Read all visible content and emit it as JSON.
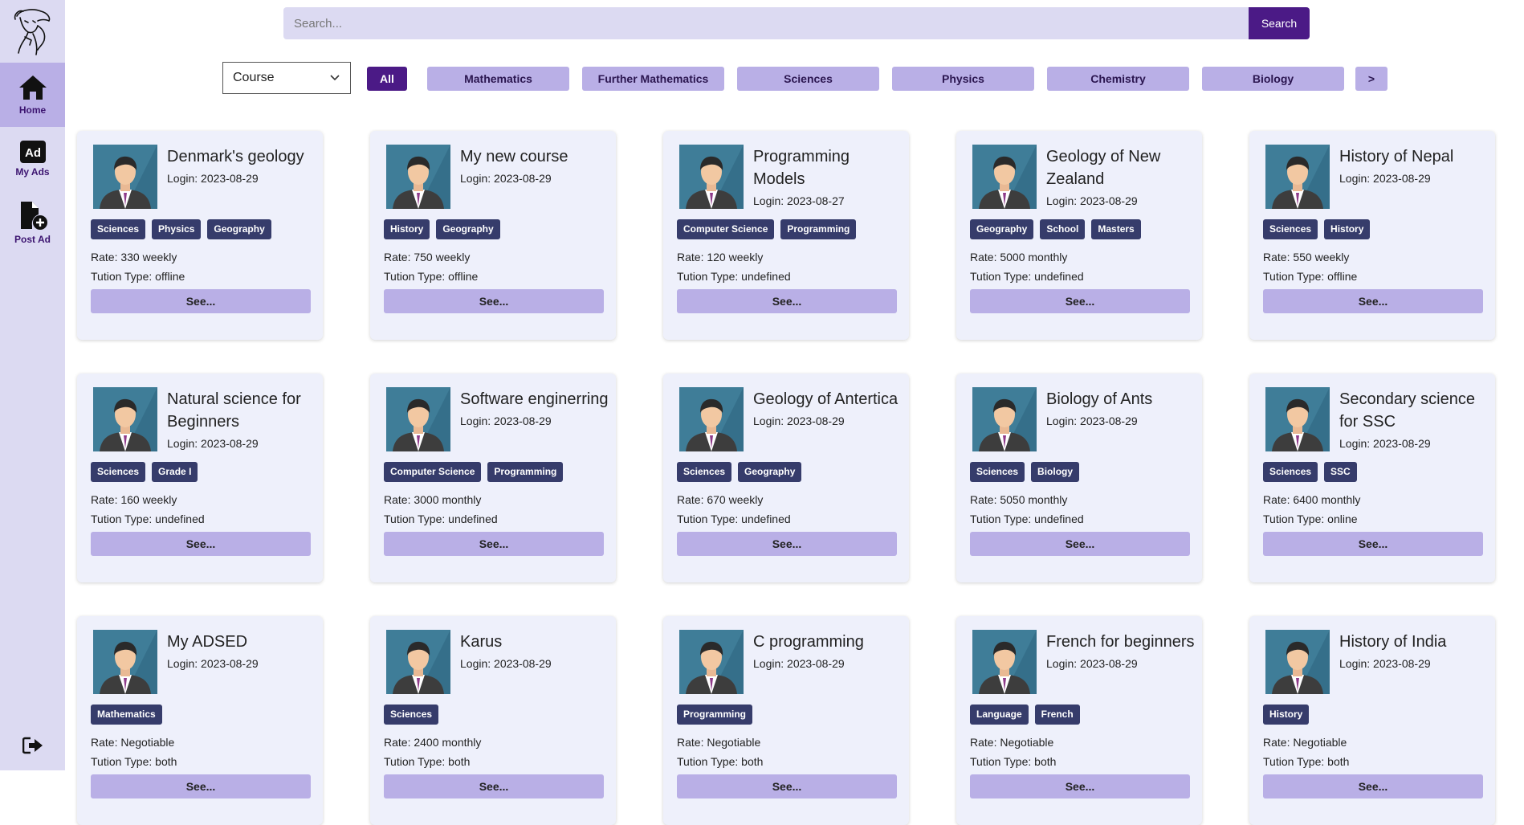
{
  "sidebar": {
    "items": [
      {
        "label": "Home",
        "icon": "home-icon"
      },
      {
        "label": "My Ads",
        "icon": "ad-icon"
      },
      {
        "label": "Post Ad",
        "icon": "file-plus-icon"
      }
    ],
    "logout_icon": "logout-icon"
  },
  "search": {
    "placeholder": "Search...",
    "button": "Search"
  },
  "filters": {
    "select_value": "Course",
    "chips": [
      "All",
      "Mathematics",
      "Further Mathematics",
      "Sciences",
      "Physics",
      "Chemistry",
      "Biology",
      ">"
    ]
  },
  "cards": [
    {
      "title": "Denmark's geology",
      "login": "Login: 2023-08-29",
      "tags": [
        "Sciences",
        "Physics",
        "Geography"
      ],
      "rate": "Rate: 330 weekly",
      "type": "Tution Type: offline",
      "button": "See..."
    },
    {
      "title": "My new course",
      "login": "Login: 2023-08-29",
      "tags": [
        "History",
        "Geography"
      ],
      "rate": "Rate: 750 weekly",
      "type": "Tution Type: offline",
      "button": "See..."
    },
    {
      "title": "Programming Models",
      "login": "Login: 2023-08-27",
      "tags": [
        "Computer Science",
        "Programming"
      ],
      "rate": "Rate: 120 weekly",
      "type": "Tution Type: undefined",
      "button": "See..."
    },
    {
      "title": "Geology of New Zealand",
      "login": "Login: 2023-08-29",
      "tags": [
        "Geography",
        "School",
        "Masters"
      ],
      "rate": "Rate: 5000 monthly",
      "type": "Tution Type: undefined",
      "button": "See..."
    },
    {
      "title": "History of Nepal",
      "login": "Login: 2023-08-29",
      "tags": [
        "Sciences",
        "History"
      ],
      "rate": "Rate: 550 weekly",
      "type": "Tution Type: offline",
      "button": "See..."
    },
    {
      "title": "Natural science for Beginners",
      "login": "Login: 2023-08-29",
      "tags": [
        "Sciences",
        "Grade I"
      ],
      "rate": "Rate: 160 weekly",
      "type": "Tution Type: undefined",
      "button": "See..."
    },
    {
      "title": "Software enginerring",
      "login": "Login: 2023-08-29",
      "tags": [
        "Computer Science",
        "Programming"
      ],
      "rate": "Rate: 3000 monthly",
      "type": "Tution Type: undefined",
      "button": "See..."
    },
    {
      "title": "Geology of Antertica",
      "login": "Login: 2023-08-29",
      "tags": [
        "Sciences",
        "Geography"
      ],
      "rate": "Rate: 670 weekly",
      "type": "Tution Type: undefined",
      "button": "See..."
    },
    {
      "title": "Biology of Ants",
      "login": "Login: 2023-08-29",
      "tags": [
        "Sciences",
        "Biology"
      ],
      "rate": "Rate: 5050 monthly",
      "type": "Tution Type: undefined",
      "button": "See..."
    },
    {
      "title": "Secondary science for SSC",
      "login": "Login: 2023-08-29",
      "tags": [
        "Sciences",
        "SSC"
      ],
      "rate": "Rate: 6400 monthly",
      "type": "Tution Type: online",
      "button": "See..."
    },
    {
      "title": "My ADSED",
      "login": "Login: 2023-08-29",
      "tags": [
        "Mathematics"
      ],
      "rate": "Rate: Negotiable",
      "type": "Tution Type: both",
      "button": "See..."
    },
    {
      "title": "Karus",
      "login": "Login: 2023-08-29",
      "tags": [
        "Sciences"
      ],
      "rate": "Rate: 2400 monthly",
      "type": "Tution Type: both",
      "button": "See..."
    },
    {
      "title": "C programming",
      "login": "Login: 2023-08-29",
      "tags": [
        "Programming"
      ],
      "rate": "Rate: Negotiable",
      "type": "Tution Type: both",
      "button": "See..."
    },
    {
      "title": "French for beginners",
      "login": "Login: 2023-08-29",
      "tags": [
        "Language",
        "French"
      ],
      "rate": "Rate: Negotiable",
      "type": "Tution Type: both",
      "button": "See..."
    },
    {
      "title": "History of India",
      "login": "Login: 2023-08-29",
      "tags": [
        "History"
      ],
      "rate": "Rate: Negotiable",
      "type": "Tution Type: both",
      "button": "See..."
    }
  ],
  "colors": {
    "accent": "#4b1a86",
    "chip": "#b9afe6",
    "sidebar": "#dcdaf2",
    "card": "#eef0fb",
    "tag": "#363c6b"
  }
}
